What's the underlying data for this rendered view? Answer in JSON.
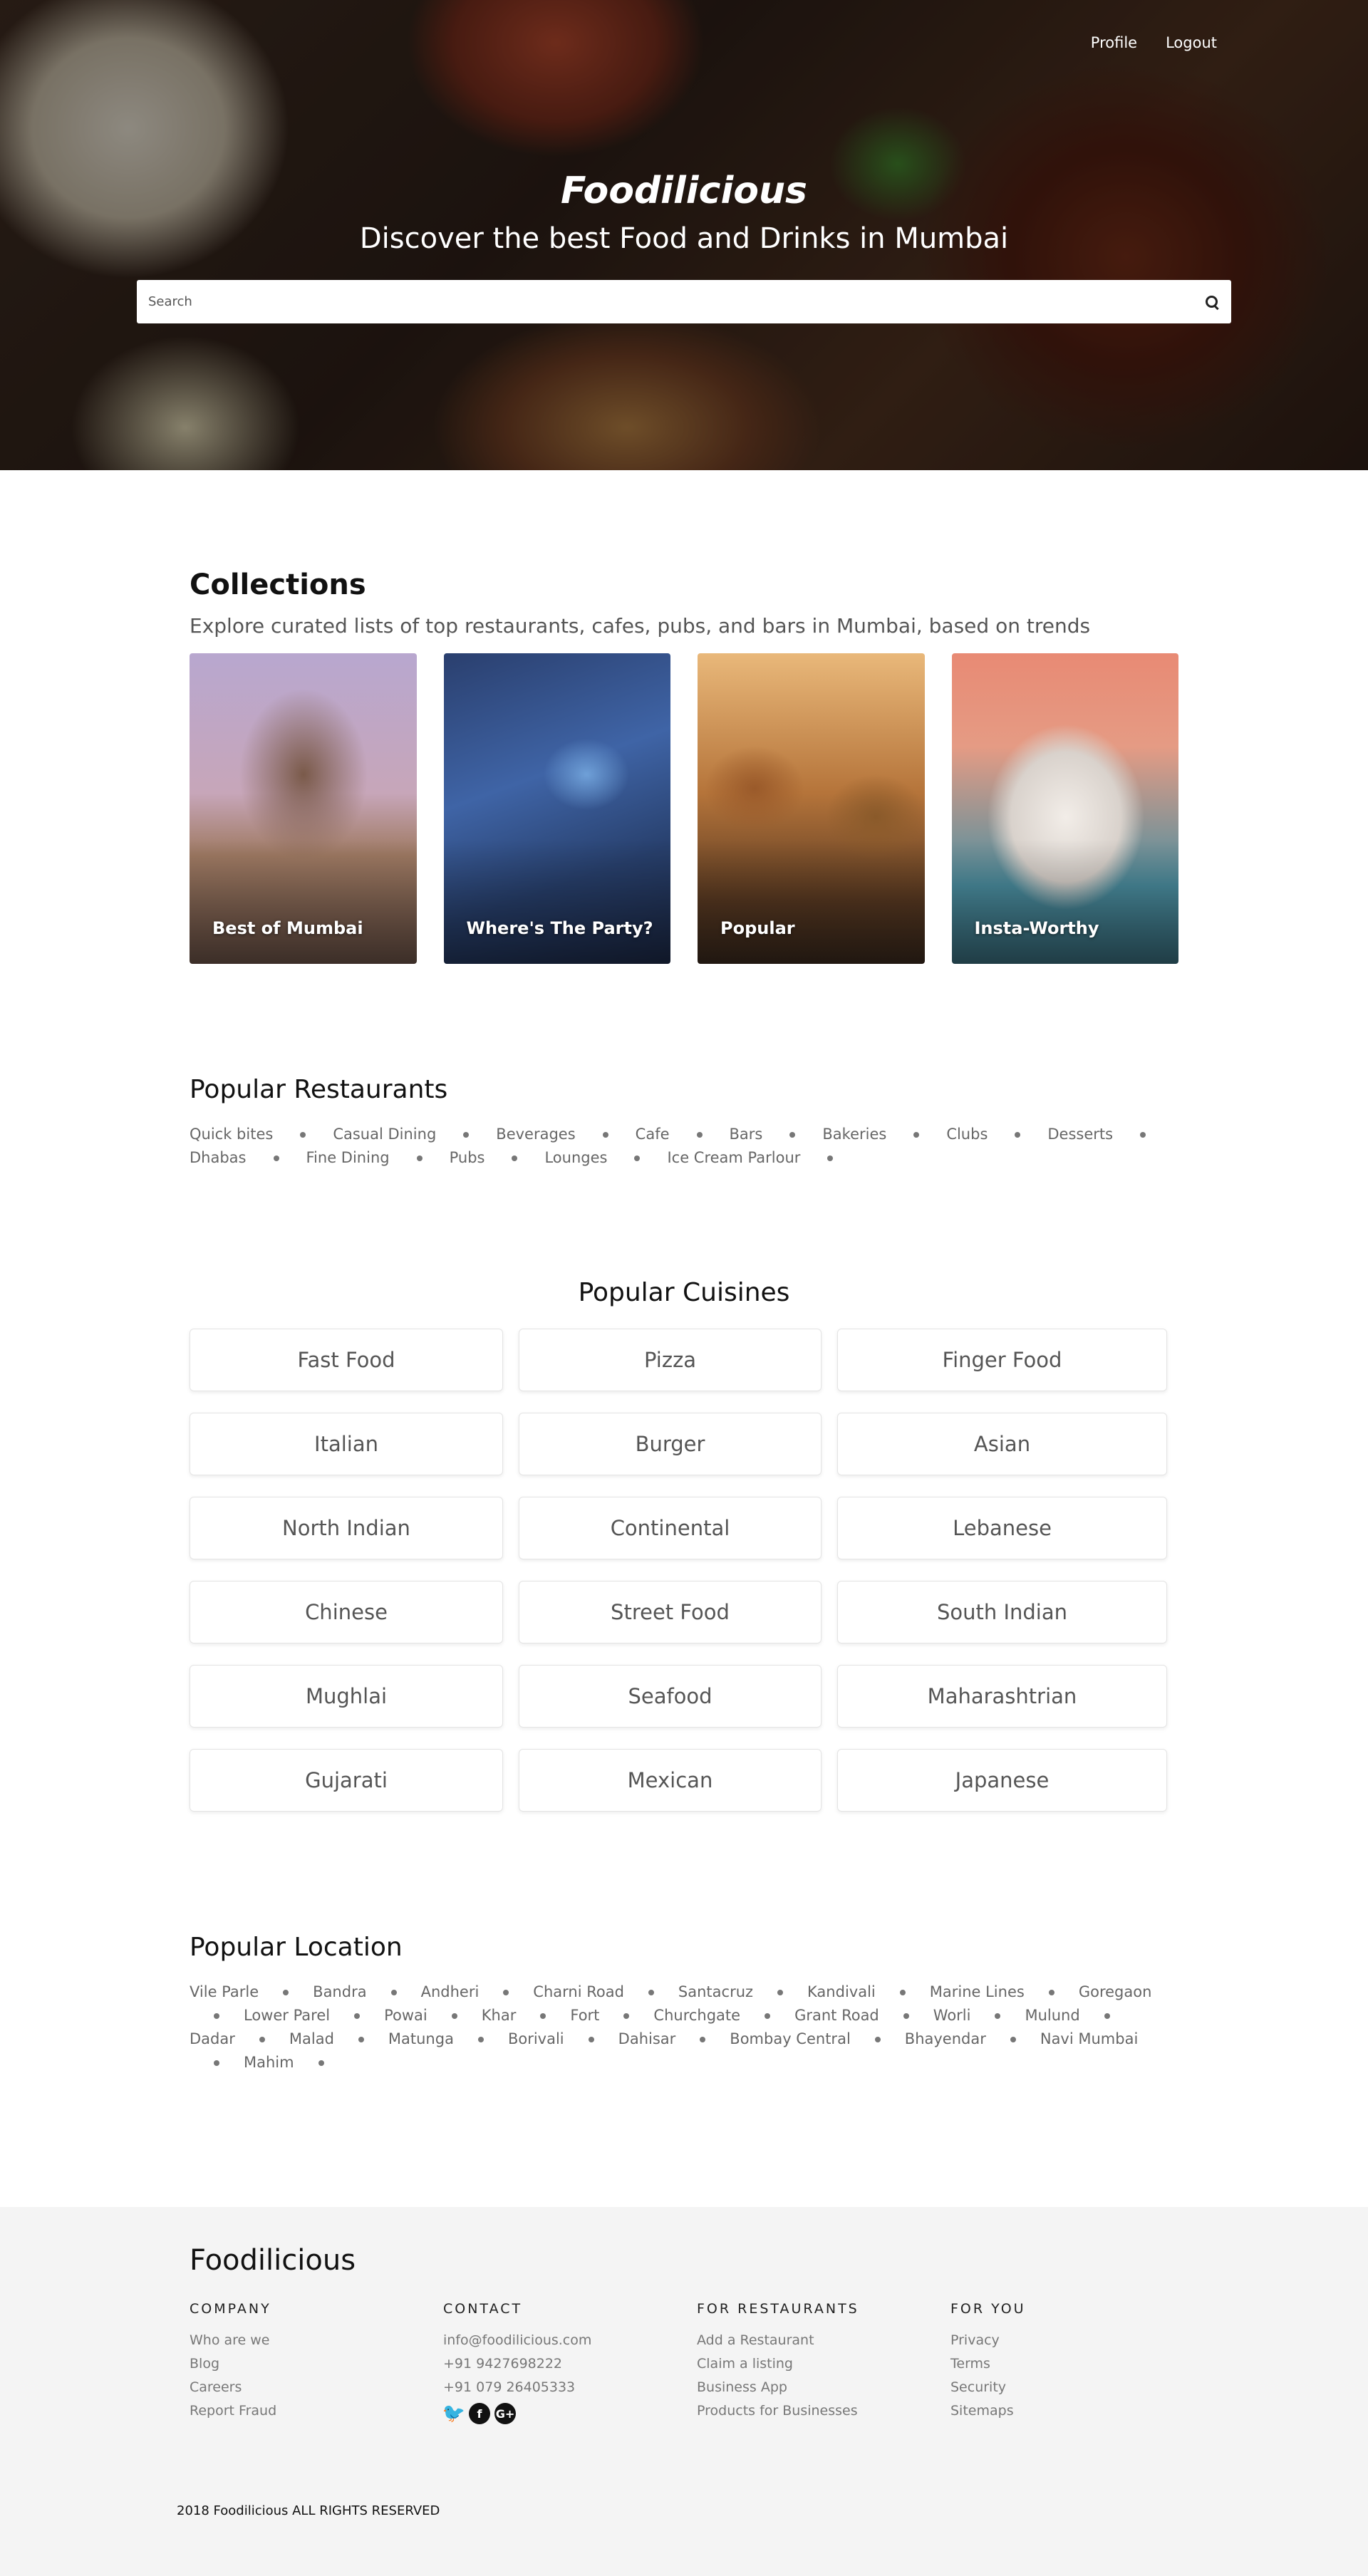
{
  "nav": {
    "profile": "Profile",
    "logout": "Logout"
  },
  "hero": {
    "title": "Foodilicious",
    "subtitle": "Discover the best Food and Drinks in Mumbai",
    "search_placeholder": "Search"
  },
  "collections": {
    "title": "Collections",
    "subtitle": "Explore curated lists of top restaurants, cafes, pubs, and bars in Mumbai, based on trends",
    "cards": [
      {
        "label": "Best of Mumbai"
      },
      {
        "label": "Where's The Party?"
      },
      {
        "label": "Popular"
      },
      {
        "label": "Insta-Worthy"
      }
    ]
  },
  "restaurants": {
    "title": "Popular Restaurants",
    "items": [
      "Quick bites",
      "Casual Dining",
      "Beverages",
      "Cafe",
      "Bars",
      "Bakeries",
      "Clubs",
      "Desserts",
      "Dhabas",
      "Fine Dining",
      "Pubs",
      "Lounges",
      "Ice Cream Parlour"
    ]
  },
  "cuisines": {
    "title": "Popular Cuisines",
    "items": [
      "Fast Food",
      "Pizza",
      "Finger Food",
      "Italian",
      "Burger",
      "Asian",
      "North Indian",
      "Continental",
      "Lebanese",
      "Chinese",
      "Street Food",
      "South Indian",
      "Mughlai",
      "Seafood",
      "Maharashtrian",
      "Gujarati",
      "Mexican",
      "Japanese"
    ]
  },
  "locations": {
    "title": "Popular Location",
    "items": [
      "Vile Parle",
      "Bandra",
      "Andheri",
      "Charni Road",
      "Santacruz",
      "Kandivali",
      "Marine Lines",
      "Goregaon",
      "Lower Parel",
      "Powai",
      "Khar",
      "Fort",
      "Churchgate",
      "Grant Road",
      "Worli",
      "Mulund",
      "Dadar",
      "Malad",
      "Matunga",
      "Borivali",
      "Dahisar",
      "Bombay Central",
      "Bhayendar",
      "Navi Mumbai",
      "Mahim"
    ]
  },
  "footer": {
    "brand": "Foodilicious",
    "company": {
      "heading": "COMPANY",
      "links": [
        "Who are we",
        "Blog",
        "Careers",
        "Report Fraud"
      ]
    },
    "contact": {
      "heading": "CONTACT",
      "links": [
        "info@foodilicious.com",
        "+91 9427698222",
        "+91 079 26405333"
      ]
    },
    "restaurants": {
      "heading": "FOR RESTAURANTS",
      "links": [
        "Add a Restaurant",
        "Claim a listing",
        "Business App",
        "Products for Businesses"
      ]
    },
    "you": {
      "heading": "FOR YOU",
      "links": [
        "Privacy",
        "Terms",
        "Security",
        "Sitemaps"
      ]
    },
    "social_icons": [
      "twitter-icon",
      "facebook-icon",
      "google-plus-icon"
    ],
    "copyright": "2018 Foodilicious ALL RIGHTS RESERVED"
  }
}
